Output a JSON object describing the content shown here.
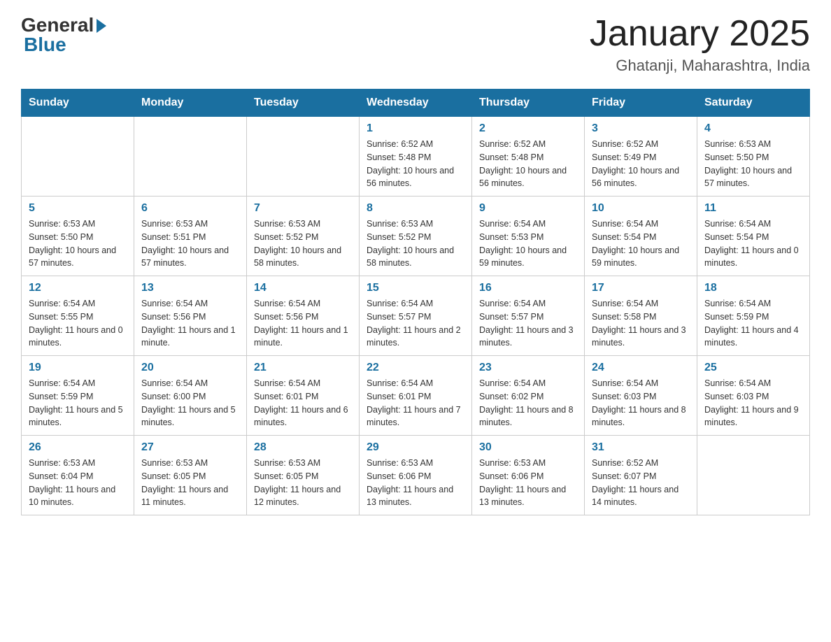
{
  "logo": {
    "general": "General",
    "blue": "Blue"
  },
  "title": {
    "month_year": "January 2025",
    "location": "Ghatanji, Maharashtra, India"
  },
  "headers": [
    "Sunday",
    "Monday",
    "Tuesday",
    "Wednesday",
    "Thursday",
    "Friday",
    "Saturday"
  ],
  "weeks": [
    [
      {
        "day": "",
        "info": ""
      },
      {
        "day": "",
        "info": ""
      },
      {
        "day": "",
        "info": ""
      },
      {
        "day": "1",
        "info": "Sunrise: 6:52 AM\nSunset: 5:48 PM\nDaylight: 10 hours\nand 56 minutes."
      },
      {
        "day": "2",
        "info": "Sunrise: 6:52 AM\nSunset: 5:48 PM\nDaylight: 10 hours\nand 56 minutes."
      },
      {
        "day": "3",
        "info": "Sunrise: 6:52 AM\nSunset: 5:49 PM\nDaylight: 10 hours\nand 56 minutes."
      },
      {
        "day": "4",
        "info": "Sunrise: 6:53 AM\nSunset: 5:50 PM\nDaylight: 10 hours\nand 57 minutes."
      }
    ],
    [
      {
        "day": "5",
        "info": "Sunrise: 6:53 AM\nSunset: 5:50 PM\nDaylight: 10 hours\nand 57 minutes."
      },
      {
        "day": "6",
        "info": "Sunrise: 6:53 AM\nSunset: 5:51 PM\nDaylight: 10 hours\nand 57 minutes."
      },
      {
        "day": "7",
        "info": "Sunrise: 6:53 AM\nSunset: 5:52 PM\nDaylight: 10 hours\nand 58 minutes."
      },
      {
        "day": "8",
        "info": "Sunrise: 6:53 AM\nSunset: 5:52 PM\nDaylight: 10 hours\nand 58 minutes."
      },
      {
        "day": "9",
        "info": "Sunrise: 6:54 AM\nSunset: 5:53 PM\nDaylight: 10 hours\nand 59 minutes."
      },
      {
        "day": "10",
        "info": "Sunrise: 6:54 AM\nSunset: 5:54 PM\nDaylight: 10 hours\nand 59 minutes."
      },
      {
        "day": "11",
        "info": "Sunrise: 6:54 AM\nSunset: 5:54 PM\nDaylight: 11 hours\nand 0 minutes."
      }
    ],
    [
      {
        "day": "12",
        "info": "Sunrise: 6:54 AM\nSunset: 5:55 PM\nDaylight: 11 hours\nand 0 minutes."
      },
      {
        "day": "13",
        "info": "Sunrise: 6:54 AM\nSunset: 5:56 PM\nDaylight: 11 hours\nand 1 minute."
      },
      {
        "day": "14",
        "info": "Sunrise: 6:54 AM\nSunset: 5:56 PM\nDaylight: 11 hours\nand 1 minute."
      },
      {
        "day": "15",
        "info": "Sunrise: 6:54 AM\nSunset: 5:57 PM\nDaylight: 11 hours\nand 2 minutes."
      },
      {
        "day": "16",
        "info": "Sunrise: 6:54 AM\nSunset: 5:57 PM\nDaylight: 11 hours\nand 3 minutes."
      },
      {
        "day": "17",
        "info": "Sunrise: 6:54 AM\nSunset: 5:58 PM\nDaylight: 11 hours\nand 3 minutes."
      },
      {
        "day": "18",
        "info": "Sunrise: 6:54 AM\nSunset: 5:59 PM\nDaylight: 11 hours\nand 4 minutes."
      }
    ],
    [
      {
        "day": "19",
        "info": "Sunrise: 6:54 AM\nSunset: 5:59 PM\nDaylight: 11 hours\nand 5 minutes."
      },
      {
        "day": "20",
        "info": "Sunrise: 6:54 AM\nSunset: 6:00 PM\nDaylight: 11 hours\nand 5 minutes."
      },
      {
        "day": "21",
        "info": "Sunrise: 6:54 AM\nSunset: 6:01 PM\nDaylight: 11 hours\nand 6 minutes."
      },
      {
        "day": "22",
        "info": "Sunrise: 6:54 AM\nSunset: 6:01 PM\nDaylight: 11 hours\nand 7 minutes."
      },
      {
        "day": "23",
        "info": "Sunrise: 6:54 AM\nSunset: 6:02 PM\nDaylight: 11 hours\nand 8 minutes."
      },
      {
        "day": "24",
        "info": "Sunrise: 6:54 AM\nSunset: 6:03 PM\nDaylight: 11 hours\nand 8 minutes."
      },
      {
        "day": "25",
        "info": "Sunrise: 6:54 AM\nSunset: 6:03 PM\nDaylight: 11 hours\nand 9 minutes."
      }
    ],
    [
      {
        "day": "26",
        "info": "Sunrise: 6:53 AM\nSunset: 6:04 PM\nDaylight: 11 hours\nand 10 minutes."
      },
      {
        "day": "27",
        "info": "Sunrise: 6:53 AM\nSunset: 6:05 PM\nDaylight: 11 hours\nand 11 minutes."
      },
      {
        "day": "28",
        "info": "Sunrise: 6:53 AM\nSunset: 6:05 PM\nDaylight: 11 hours\nand 12 minutes."
      },
      {
        "day": "29",
        "info": "Sunrise: 6:53 AM\nSunset: 6:06 PM\nDaylight: 11 hours\nand 13 minutes."
      },
      {
        "day": "30",
        "info": "Sunrise: 6:53 AM\nSunset: 6:06 PM\nDaylight: 11 hours\nand 13 minutes."
      },
      {
        "day": "31",
        "info": "Sunrise: 6:52 AM\nSunset: 6:07 PM\nDaylight: 11 hours\nand 14 minutes."
      },
      {
        "day": "",
        "info": ""
      }
    ]
  ]
}
